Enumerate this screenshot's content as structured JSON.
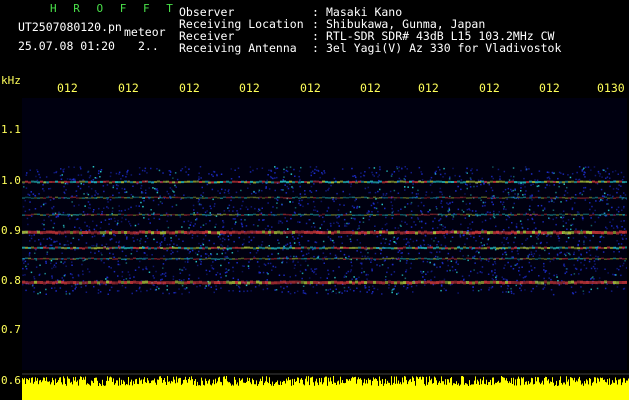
{
  "header": {
    "title": "H R O F F T",
    "filename": "UT2507080120.pn",
    "tag": "meteor",
    "datetime": "25.07.08 01:20",
    "counter": "2..",
    "meta": [
      {
        "label": "Observer",
        "sep": ":",
        "value": "Masaki Kano"
      },
      {
        "label": "Receiving Location",
        "sep": ":",
        "value": "Shibukawa, Gunma, Japan"
      },
      {
        "label": "Receiver",
        "sep": ":",
        "value": "RTL-SDR SDR# 43dB L15 103.2MHz CW"
      },
      {
        "label": "Receiving Antenna",
        "sep": ":",
        "value": "3el Yagi(V) Az 330 for Vladivostok"
      }
    ]
  },
  "axis": {
    "unit": "kHz",
    "y_ticks": [
      "1.1",
      "1.0",
      "0.9",
      "0.8",
      "0.7",
      "0.6"
    ],
    "x_ticks": [
      "012",
      "012",
      "012",
      "012",
      "012",
      "012",
      "012",
      "012",
      "012",
      "0130"
    ]
  },
  "colors": {
    "background": "#000000",
    "plot_bg": "#00001a",
    "axis_text": "#ffff5a",
    "title_green": "#49e049",
    "strip_yellow": "#ffff00",
    "signal_low": "#1e2fd8",
    "signal_mid": "#2bd8d8",
    "signal_high": "#e84040"
  }
}
